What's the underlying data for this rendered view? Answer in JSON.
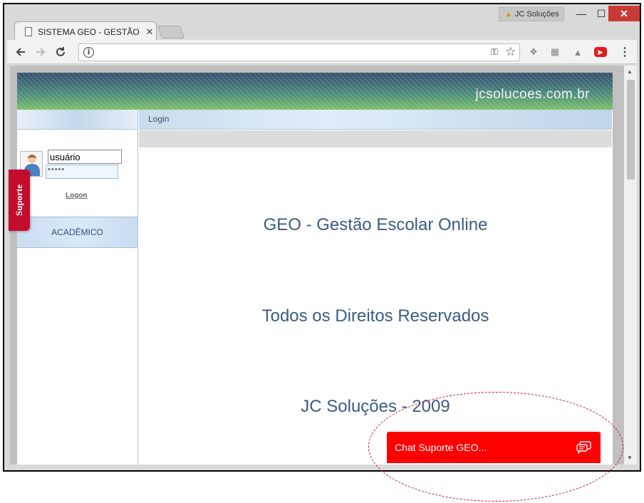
{
  "browser": {
    "profile_name": "JC Soluções",
    "tab_title": "SISTEMA GEO - GESTÃO",
    "tab_close": "✕",
    "url": "",
    "window_controls": {
      "minimize": "—",
      "maximize": "☐",
      "close": "✕"
    }
  },
  "banner": {
    "site": "jcsolucoes.com.br"
  },
  "sidebar": {
    "username_value": "usuário",
    "password_mask": "•••••",
    "logon_label": "Logon",
    "menu_item": "ACADÊMICO"
  },
  "main": {
    "header": "Login",
    "lines": [
      "GEO - Gestão Escolar Online",
      "Todos os Direitos Reservados",
      "JC Soluções - 2009"
    ]
  },
  "widgets": {
    "suporte_label": "Suporte",
    "chat_label": "Chat Suporte GEO..."
  },
  "colors": {
    "chat": "#ff0000",
    "suporte": "#c40c2c",
    "accent": "#3b5b84"
  }
}
